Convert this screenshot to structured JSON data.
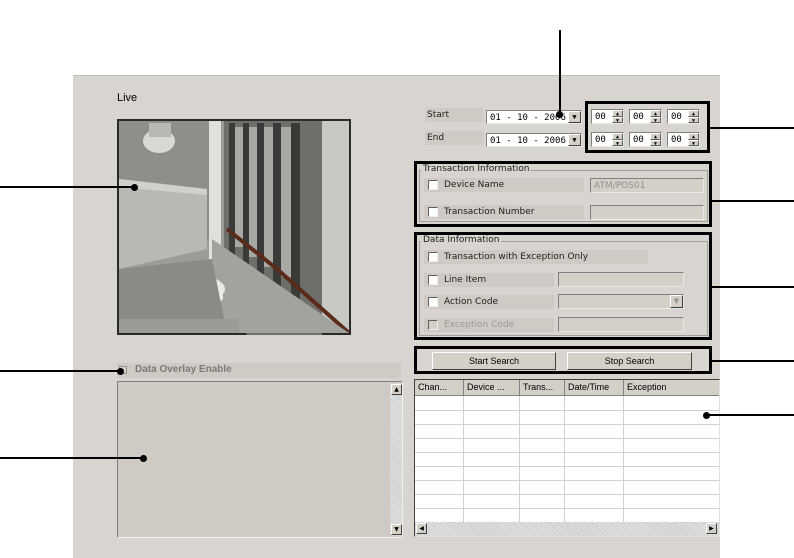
{
  "live": {
    "title": "Live"
  },
  "video": {
    "description": "camera-feed"
  },
  "overlay": {
    "label": "Data Overlay Enable"
  },
  "search": {
    "start_label": "Start",
    "end_label": "End",
    "start_date": "01 - 10 - 2006",
    "end_date": "01 - 10 - 2006",
    "start_time": [
      "00",
      "00",
      "00"
    ],
    "end_time": [
      "00",
      "00",
      "00"
    ]
  },
  "transaction": {
    "group_title": "Transaction Information",
    "device_name_label": "Device Name",
    "device_name_value": "ATM/POS01",
    "transaction_number_label": "Transaction Number",
    "transaction_number_value": ""
  },
  "data_info": {
    "group_title": "Data Information",
    "exception_only_label": "Transaction with Exception Only",
    "line_item_label": "Line Item",
    "action_code_label": "Action Code",
    "exception_code_label": "Exception Code"
  },
  "buttons": {
    "start_search": "Start Search",
    "stop_search": "Stop Search"
  },
  "results": {
    "columns": [
      "Chan...",
      "Device ...",
      "Trans...",
      "Date/Time",
      "Exception"
    ],
    "rows": []
  },
  "icons": {
    "dropdown": "dropdown-arrow-icon",
    "spin_up": "spin-up-icon",
    "spin_down": "spin-down-icon",
    "scroll_left": "scroll-left-icon",
    "scroll_right": "scroll-right-icon",
    "scroll_up": "scroll-up-icon",
    "scroll_down": "scroll-down-icon"
  }
}
